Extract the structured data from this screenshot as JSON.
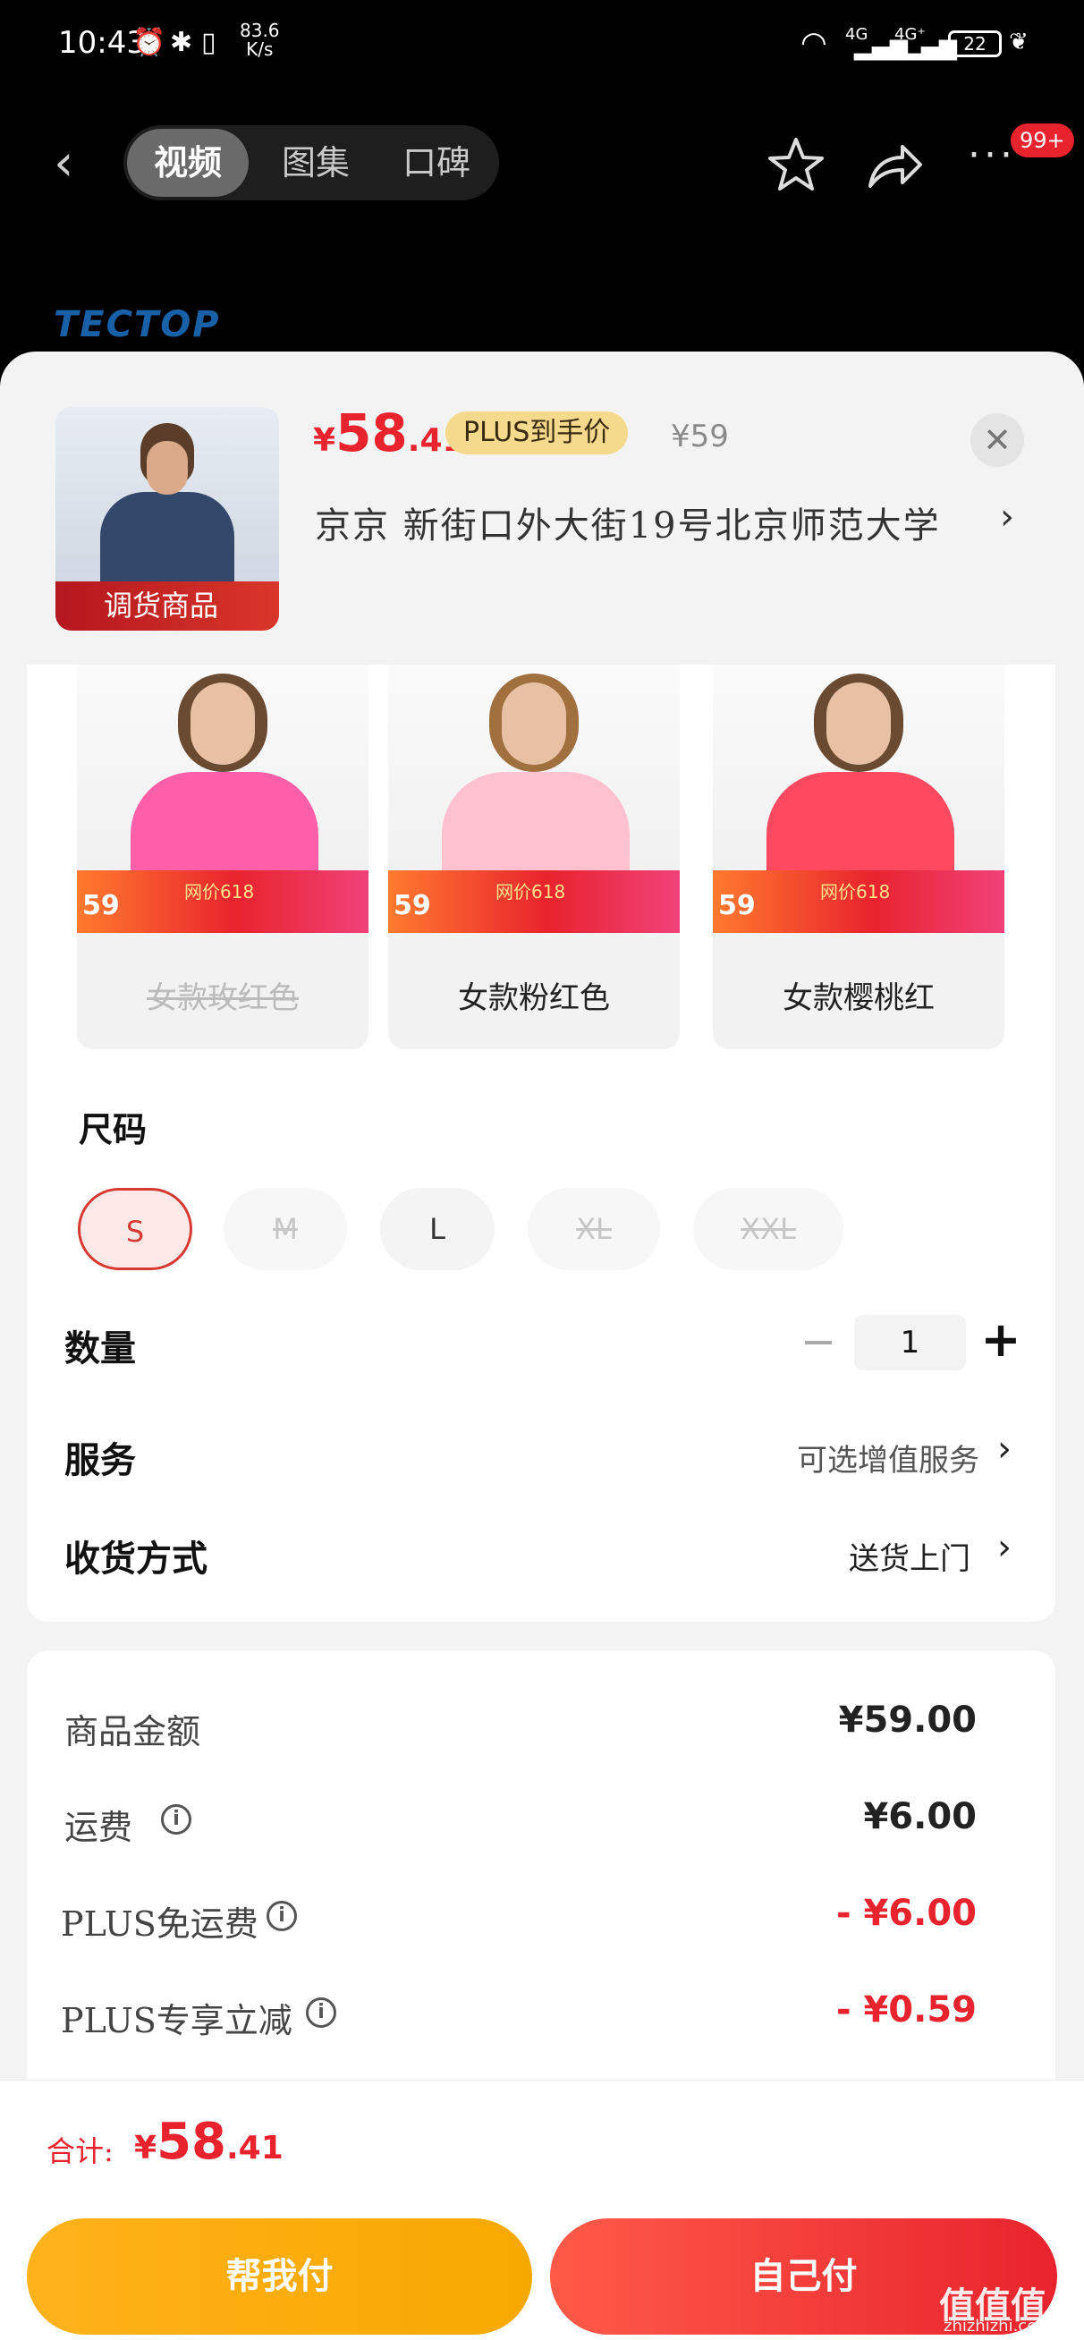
{
  "status_bar": {
    "time": "10:43",
    "net_speed": "83.6",
    "net_unit": "K/s",
    "battery": "22",
    "signal1": "4G",
    "signal2": "4G⁺"
  },
  "nav": {
    "tabs": [
      "视频",
      "图集",
      "口碑"
    ],
    "active_tab": "视频",
    "badge": "99+"
  },
  "brand_watermark": "TECTOP",
  "product": {
    "thumb_tag": "调货商品",
    "price_currency": "¥",
    "price_int": "58",
    "price_dec": ".41",
    "plus_label": "PLUS到手价",
    "original_price": "¥59",
    "address": "京京  新街口外大街19号北京师范大学"
  },
  "colors": [
    {
      "label": "女款玫红色",
      "available": false,
      "coat": "#ff5fa9",
      "price": "59"
    },
    {
      "label": "女款粉红色",
      "available": true,
      "coat": "#ffc0cf",
      "price": "59"
    },
    {
      "label": "女款樱桃红",
      "available": true,
      "coat": "#ff4960",
      "price": "59"
    }
  ],
  "promo_text": "网价618",
  "size_section": {
    "title": "尺码",
    "options": [
      {
        "label": "S",
        "state": "selected"
      },
      {
        "label": "M",
        "state": "disabled"
      },
      {
        "label": "L",
        "state": "normal"
      },
      {
        "label": "XL",
        "state": "disabled"
      },
      {
        "label": "XXL",
        "state": "disabled"
      }
    ]
  },
  "quantity": {
    "label": "数量",
    "value": "1",
    "minus": "−",
    "plus": "+"
  },
  "service": {
    "label": "服务",
    "value": "可选增值服务"
  },
  "delivery": {
    "label": "收货方式",
    "value": "送货上门"
  },
  "fees": [
    {
      "label": "商品金额",
      "value": "¥59.00",
      "info": false,
      "red": false
    },
    {
      "label": "运费",
      "value": "¥6.00",
      "info": true,
      "red": false
    },
    {
      "label": "PLUS免运费",
      "value": "- ¥6.00",
      "info": true,
      "red": true
    },
    {
      "label": "PLUS专享立减",
      "value": "- ¥0.59",
      "info": true,
      "red": true
    }
  ],
  "footer": {
    "total_label": "合计:",
    "total_currency": "¥",
    "total_int": "58",
    "total_dec": ".41",
    "help_pay": "帮我付",
    "self_pay": "自己付"
  },
  "site_watermark": {
    "glyphs": "值值值",
    "url": "zhizhizhi.com"
  }
}
